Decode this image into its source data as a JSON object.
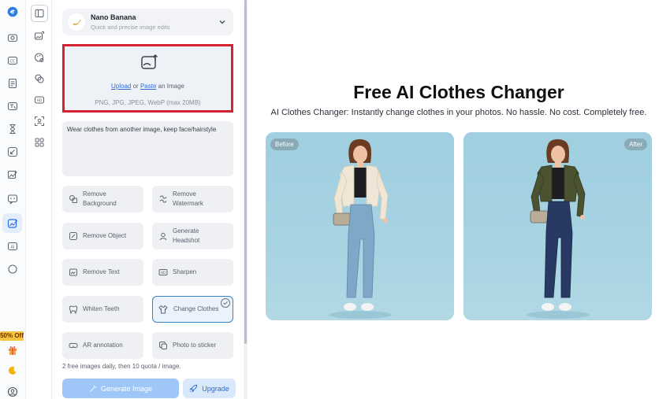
{
  "promo": {
    "label": "50% Off"
  },
  "model": {
    "name": "Nano Banana",
    "description": "Quick and precise image edits"
  },
  "upload": {
    "upload_link": "Upload",
    "or_text": "or",
    "paste_link": "Paste",
    "suffix": "an Image",
    "formats": "PNG, JPG, JPEG, WebP (max 20MB)"
  },
  "prompt": {
    "value": "Wear clothes from another image, keep face/hairstyle"
  },
  "tools": [
    {
      "line1": "Remove",
      "line2": "Background"
    },
    {
      "line1": "Remove",
      "line2": "Watermark"
    },
    {
      "line1": "Remove Object",
      "line2": ""
    },
    {
      "line1": "Generate",
      "line2": "Headshot"
    },
    {
      "line1": "Remove Text",
      "line2": ""
    },
    {
      "line1": "Sharpen",
      "line2": ""
    },
    {
      "line1": "Whiten Teeth",
      "line2": ""
    },
    {
      "line1": "Change Clothes",
      "line2": ""
    },
    {
      "line1": "AR annotation",
      "line2": ""
    },
    {
      "line1": "Photo to sticker",
      "line2": ""
    }
  ],
  "quota_text": "2 free images daily, then 10 quota / image.",
  "buttons": {
    "generate": "Generate Image",
    "upgrade": "Upgrade"
  },
  "main": {
    "title": "Free AI Clothes Changer",
    "subtitle": "AI Clothes Changer: Instantly change clothes in your photos. No hassle. No cost. Completely free.",
    "before_label": "Before",
    "after_label": "After"
  },
  "colors": {
    "accent": "#2e6fd6",
    "upload_border": "#d32332",
    "promo_bg": "#f5c542"
  }
}
